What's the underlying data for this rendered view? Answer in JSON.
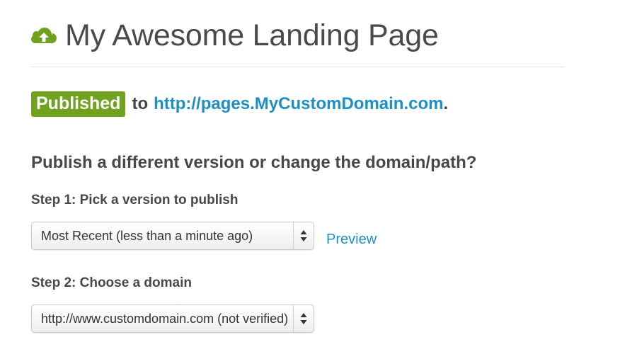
{
  "header": {
    "icon": "cloud-upload-icon",
    "title": "My Awesome Landing Page"
  },
  "status": {
    "badge": "Published",
    "to_text": "to",
    "url": "http://pages.MyCustomDomain.com",
    "period": "."
  },
  "publish_section": {
    "heading": "Publish a different version or change the domain/path?",
    "step1": {
      "label": "Step 1: Pick a version to publish",
      "selected": "Most Recent (less than a minute ago)",
      "preview_label": "Preview"
    },
    "step2": {
      "label": "Step 2: Choose a domain",
      "selected": "http://www.customdomain.com (not verified)"
    }
  },
  "colors": {
    "badge_bg": "#70a21f",
    "icon": "#70a21f",
    "link": "#1d8fc4",
    "text": "#444444"
  }
}
